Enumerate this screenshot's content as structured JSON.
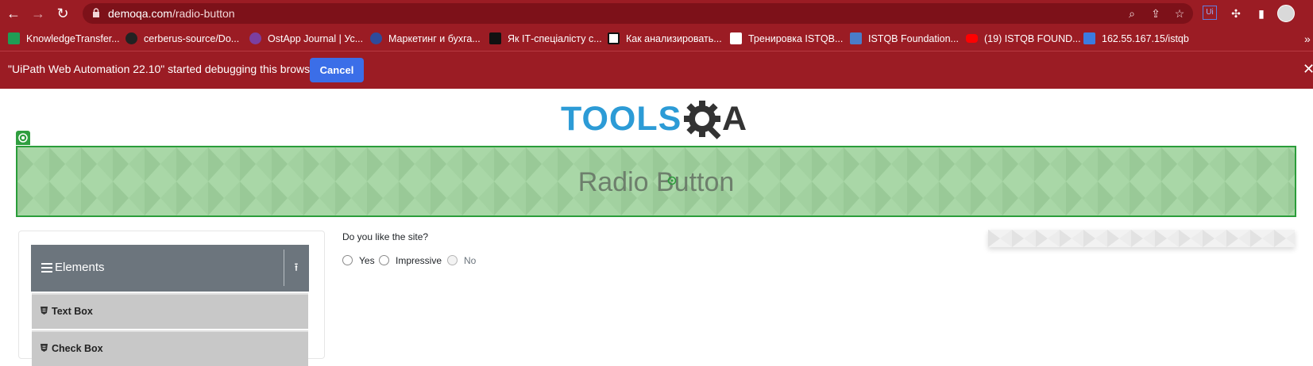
{
  "browser": {
    "url_domain": "demoqa.com",
    "url_path": "/radio-button",
    "bookmarks": [
      {
        "label": "KnowledgeTransfer...",
        "icon": "green-grid-icon",
        "color": "#1f9d55"
      },
      {
        "label": "cerberus-source/Do...",
        "icon": "github-icon",
        "color": "#222222"
      },
      {
        "label": "OstApp Journal | Ус...",
        "icon": "ostapp-icon",
        "color": "#7b3fa0"
      },
      {
        "label": "Маркетинг и бухга...",
        "icon": "star-badge-icon",
        "color": "#2e4b9b"
      },
      {
        "label": "Як ІТ-спеціалісту с...",
        "icon": "dou-icon",
        "color": "#111111"
      },
      {
        "label": "Как анализировать...",
        "icon": "flower-icon",
        "color": "#111111"
      },
      {
        "label": "Тренировка ISTQB...",
        "icon": "document-icon",
        "color": "#ffffff"
      },
      {
        "label": "ISTQB Foundation...",
        "icon": "burst-icon",
        "color": "#4a7cc9"
      },
      {
        "label": "(19) ISTQB FOUND...",
        "icon": "youtube-icon",
        "color": "#ff0000"
      },
      {
        "label": "162.55.167.15/istqb",
        "icon": "st-icon",
        "color": "#3b7be0"
      }
    ]
  },
  "infobar": {
    "message": "\"UiPath Web Automation 22.10\" started debugging this browser",
    "cancel_label": "Cancel"
  },
  "page": {
    "logo_text_left": "TOOLS",
    "logo_text_right": "A",
    "banner_title": "Radio Button"
  },
  "sidebar": {
    "group_label": "Elements",
    "items": [
      {
        "label": "Text Box"
      },
      {
        "label": "Check Box"
      }
    ]
  },
  "main": {
    "question": "Do you like the site?",
    "options": [
      {
        "label": "Yes",
        "disabled": false
      },
      {
        "label": "Impressive",
        "disabled": false
      },
      {
        "label": "No",
        "disabled": true
      }
    ]
  },
  "colors": {
    "browser_chrome": "#9b1c24",
    "highlight_green": "#2a9d3a",
    "cancel_button": "#3b6ee8",
    "sidebar_header": "#6c757d"
  }
}
